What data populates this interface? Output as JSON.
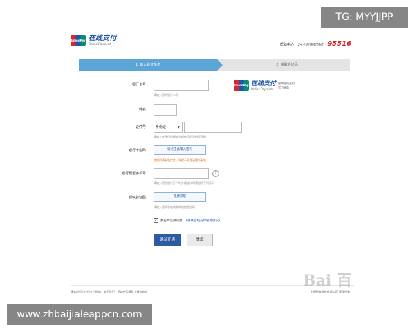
{
  "header": {
    "logo_badge": "UnionPay 银联",
    "logo_cn": "在线支付",
    "logo_en": "Online Payment",
    "help_link": "帮助中心",
    "hotline_label": "24小时客服热线",
    "hotline_number": "95516"
  },
  "steps": [
    {
      "label": "1. 输入验证信息",
      "active": true
    },
    {
      "label": "2. 获取验证码",
      "active": false
    }
  ],
  "colors": {
    "step_active": "#5ba6d6",
    "brand_blue": "#1f56a6",
    "hotline_red": "#d21f26",
    "confirm_bg": "#2d5aa0"
  },
  "form": {
    "card_number": {
      "label": "银行卡号：",
      "value": "",
      "hint": "请输入您的银行卡号"
    },
    "name": {
      "label": "姓名：",
      "value": ""
    },
    "id_number": {
      "label": "证件号：",
      "id_type": "身份证",
      "value": "",
      "hint": "请输入在银行办理该卡时使用的身份证号码"
    },
    "card_password": {
      "label": "银行卡密码：",
      "button": "请点击此输入密码",
      "warning": "使用前请安装控件，如提示失败请重新安装"
    },
    "phone": {
      "label": "银行预留手机号：",
      "value": "",
      "hint": "请输入您在银行开户时办理该卡时预留的手机号码",
      "help_icon": "?"
    },
    "sms_code": {
      "label": "短信验证码：",
      "button": "免费获取",
      "hint": "请输入您的手机收到的短信验证码"
    }
  },
  "side_logo": {
    "cn": "在线支付",
    "en": "Online Payment",
    "note1": "银联在线支付",
    "note2": "官方服务"
  },
  "agreement": {
    "checked": true,
    "text": "我已阅读并同意",
    "link": "《银联在线支付服务协议》"
  },
  "buttons": {
    "confirm": "确认开通",
    "reset": "重填"
  },
  "footer": {
    "links": "服务首页 | 在线支付指南 | 关于我们 | 网站使用条款 | 服务协议",
    "copyright": "中国银联股份有限公司 版权所有"
  },
  "watermarks": {
    "tg": "TG: MYYJJPP",
    "url": "www.zhbaijialeappcn.com",
    "baidu": "Bai 百"
  }
}
